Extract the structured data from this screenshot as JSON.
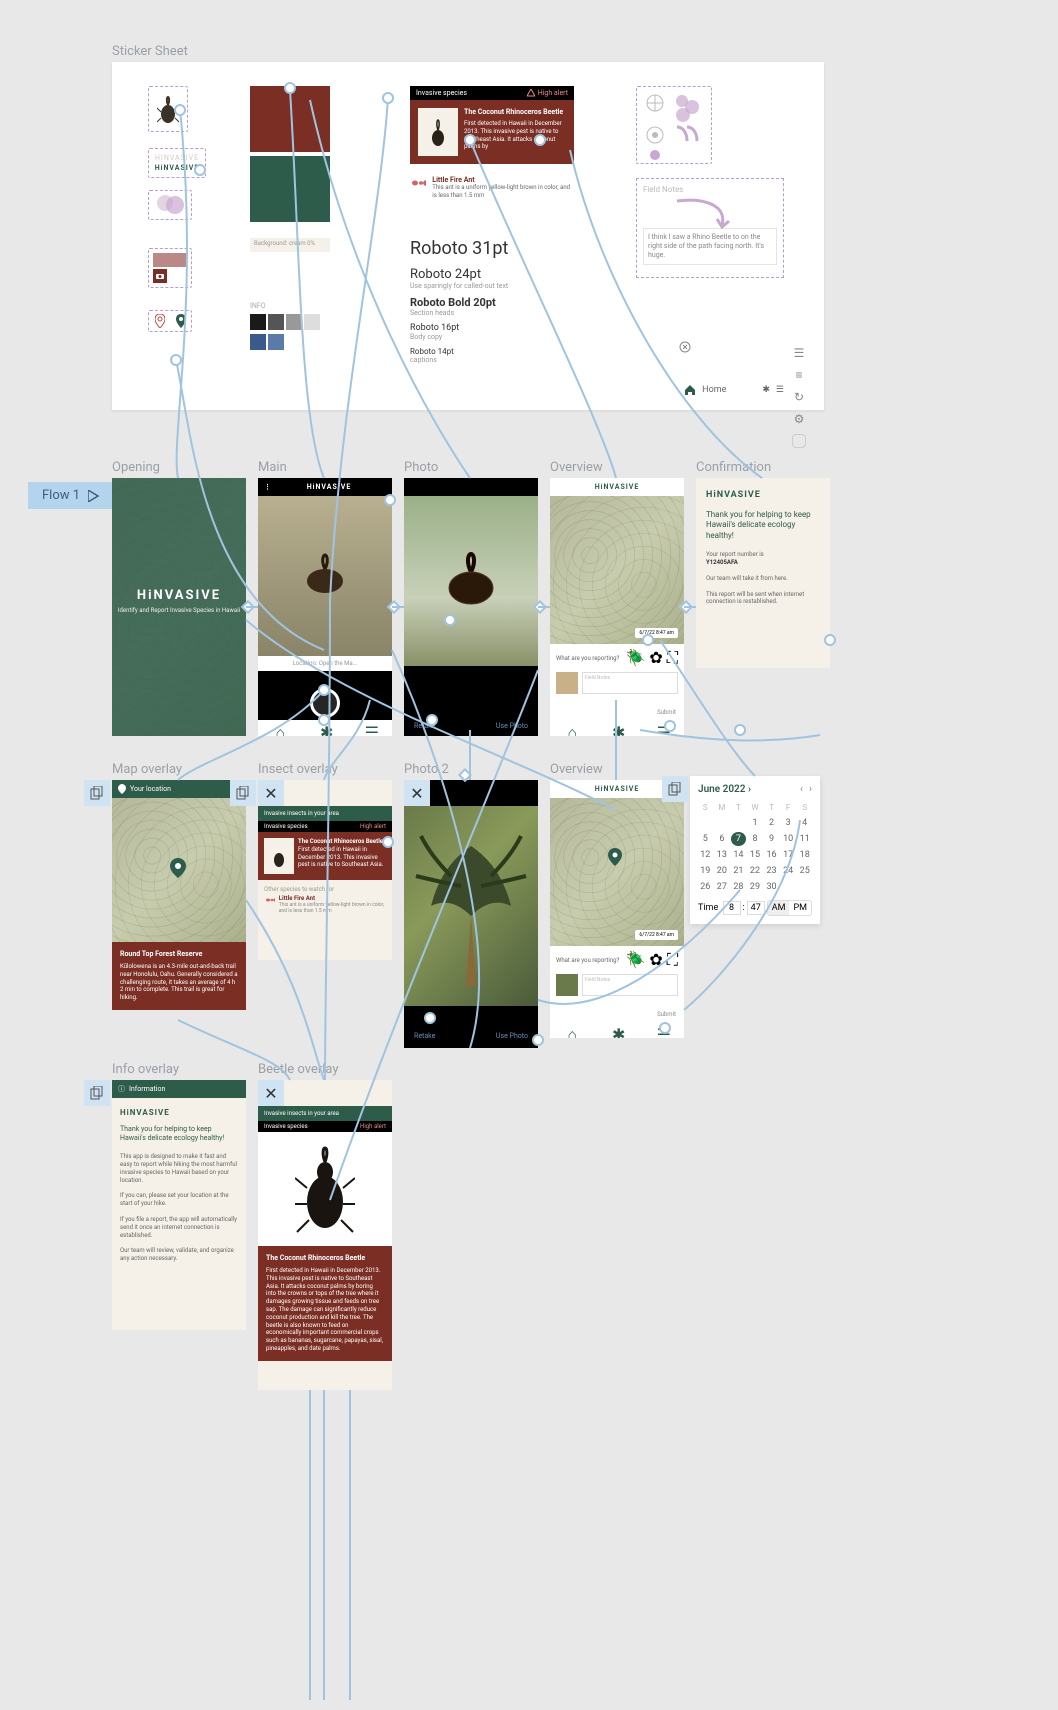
{
  "sticker_sheet": {
    "label": "Sticker Sheet",
    "brand": "HiNVASIVE",
    "brand_alt": "HINVASIVE",
    "type_specimens": {
      "h1": "Roboto 31pt",
      "h2": "Roboto 24pt",
      "h2_note": "Use sparingly for called-out text",
      "h3": "Roboto Bold 20pt",
      "h3_note": "Section heads",
      "body": "Roboto 16pt",
      "body_note": "Body copy",
      "caption": "Roboto 14pt",
      "caption_note": "captions"
    },
    "info_row_label": "INFO",
    "background_label": "Background: cream 0%",
    "home_label": "Home"
  },
  "invasive_card": {
    "banner": "Invasive species",
    "alert": "High alert",
    "title": "The Coconut Rhinoceros Beetle",
    "body": "First detected in Hawaii in December 2013. This invasive pest is native to Southeast Asia. It attacks coconut palms by"
  },
  "fire_ant": {
    "title": "Little Fire Ant",
    "body": "This ant is a uniform yellow-light brown in color, and is less than 1.5 mm"
  },
  "field_notes": {
    "placeholder": "Field Notes",
    "sample": "I think I saw a Rhino Beetle to on the right side of the path facing north. It's huge."
  },
  "flow": {
    "tag": "Flow 1"
  },
  "frames_row1": {
    "opening": {
      "label": "Opening",
      "brand": "HiNVASIVE",
      "tagline": "Identify and Report Invasive Species in Hawaii"
    },
    "main": {
      "label": "Main",
      "brand": "HiNVASIVE",
      "location": "Location: Open the Ma..."
    },
    "photo": {
      "label": "Photo",
      "retake": "Retake",
      "use": "Use Photo"
    },
    "overview": {
      "label": "Overview",
      "brand": "HiNVASIVE",
      "timestamp": "6/7/22  8:47 am",
      "question": "What are you reporting?",
      "notes_placeholder": "Field Notes",
      "submit": "Submit"
    },
    "confirmation": {
      "label": "Confirmation",
      "brand": "HiNVASIVE",
      "headline": "Thank you for helping to keep Hawaii's delicate ecology healthy!",
      "report_label": "Your report number is",
      "report_number": "Y12405AFA",
      "team": "Our team will take it from here.",
      "offline": "This report will be sent when internet connection is restablished."
    }
  },
  "frames_row2": {
    "map_overlay": {
      "label": "Map overlay",
      "location_title": "Your location",
      "place": "Round Top Forest Reserve",
      "desc": "Kūlolowena is an 4.3-mile out-and-back trail near Honolulu, Oahu. Generally considered a challenging route, it takes an average of 4 h 2 min to complete. This trail is great for hiking."
    },
    "insect_overlay": {
      "label": "Insect overlay",
      "header": "Invasive insects in your area",
      "banner": "Invasive species",
      "alert": "High alert",
      "card_title": "The Coconut Rhinoceros Beetle",
      "card_body": "First detected in Hawaii in December 2013. This invasive pest is native to Southeast Asia.",
      "other": "Other species to watch for",
      "ant_title": "Little Fire Ant",
      "ant_body": "This ant is a uniform yellow-light brown in color, and is less than 1.5 mm"
    },
    "photo2": {
      "label": "Photo 2",
      "retake": "Retake",
      "use": "Use Photo"
    },
    "overview2": {
      "label": "Overview",
      "brand": "HiNVASIVE",
      "timestamp": "6/7/22  8:47 am",
      "question": "What are you reporting?",
      "notes_placeholder": "Field Notes",
      "submit": "Submit"
    }
  },
  "calendar": {
    "month": "June 2022",
    "weekdays": [
      "S",
      "M",
      "T",
      "W",
      "T",
      "F",
      "S"
    ],
    "leading_blanks": 3,
    "days": [
      1,
      2,
      3,
      4,
      5,
      6,
      7,
      8,
      9,
      10,
      11,
      12,
      13,
      14,
      15,
      16,
      17,
      18,
      19,
      20,
      21,
      22,
      23,
      24,
      25,
      26,
      27,
      28,
      29,
      30
    ],
    "selected": 7,
    "time_label": "Time",
    "hour": "8",
    "minute": "47",
    "ampm": [
      "AM",
      "PM"
    ],
    "ampm_selected": "AM"
  },
  "frames_row3": {
    "info_overlay": {
      "label": "Info overlay",
      "header": "Information",
      "brand": "HiNVASIVE",
      "headline": "Thank you for helping to keep Hawaii's delicate ecology healthy!",
      "p1": "This app is designed to make it fast and easy to report while hiking the most harmful invasive species to Hawaii based on your location.",
      "p2": "If you can, please set your location at the start of your hike.",
      "p3": "If you file a report, the app will automatically send it once an internet connection is established.",
      "p4": "Our team will review, validate, and organize any action necessary."
    },
    "beetle_overlay": {
      "label": "Beetle overlay",
      "header": "Invasive insects in your area",
      "banner": "Invasive species",
      "alert": "High alert",
      "title": "The Coconut Rhinoceros Beetle",
      "body": "First detected in Hawaii in December 2013. This invasive pest is native to Southeast Asia. It attacks coconut palms by boring into the crowns or tops of the tree where it damages growing tissue and feeds on tree sap. The damage can significantly reduce coconut production and kill the tree. The beetle is also known to feed on economically important commercial crops such as bananas, sugarcane, papayas, sisal, pineapples, and date palms."
    }
  }
}
